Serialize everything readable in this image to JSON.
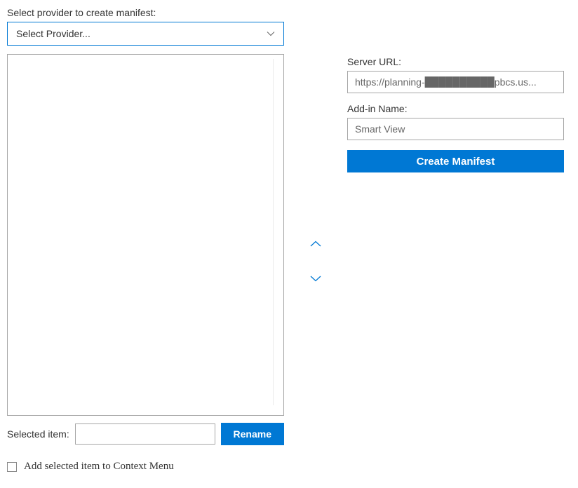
{
  "provider_section": {
    "label": "Select provider to create manifest:",
    "dropdown_placeholder": "Select Provider..."
  },
  "selected_item": {
    "label": "Selected item:",
    "value": "",
    "rename_button": "Rename"
  },
  "context_menu_checkbox": {
    "label": "Add selected item to Context Menu",
    "checked": false
  },
  "server_url": {
    "label": "Server URL:",
    "value": "https://planning-██████████pbcs.us..."
  },
  "addin_name": {
    "label": "Add-in Name:",
    "value": "Smart View"
  },
  "create_button": "Create Manifest"
}
